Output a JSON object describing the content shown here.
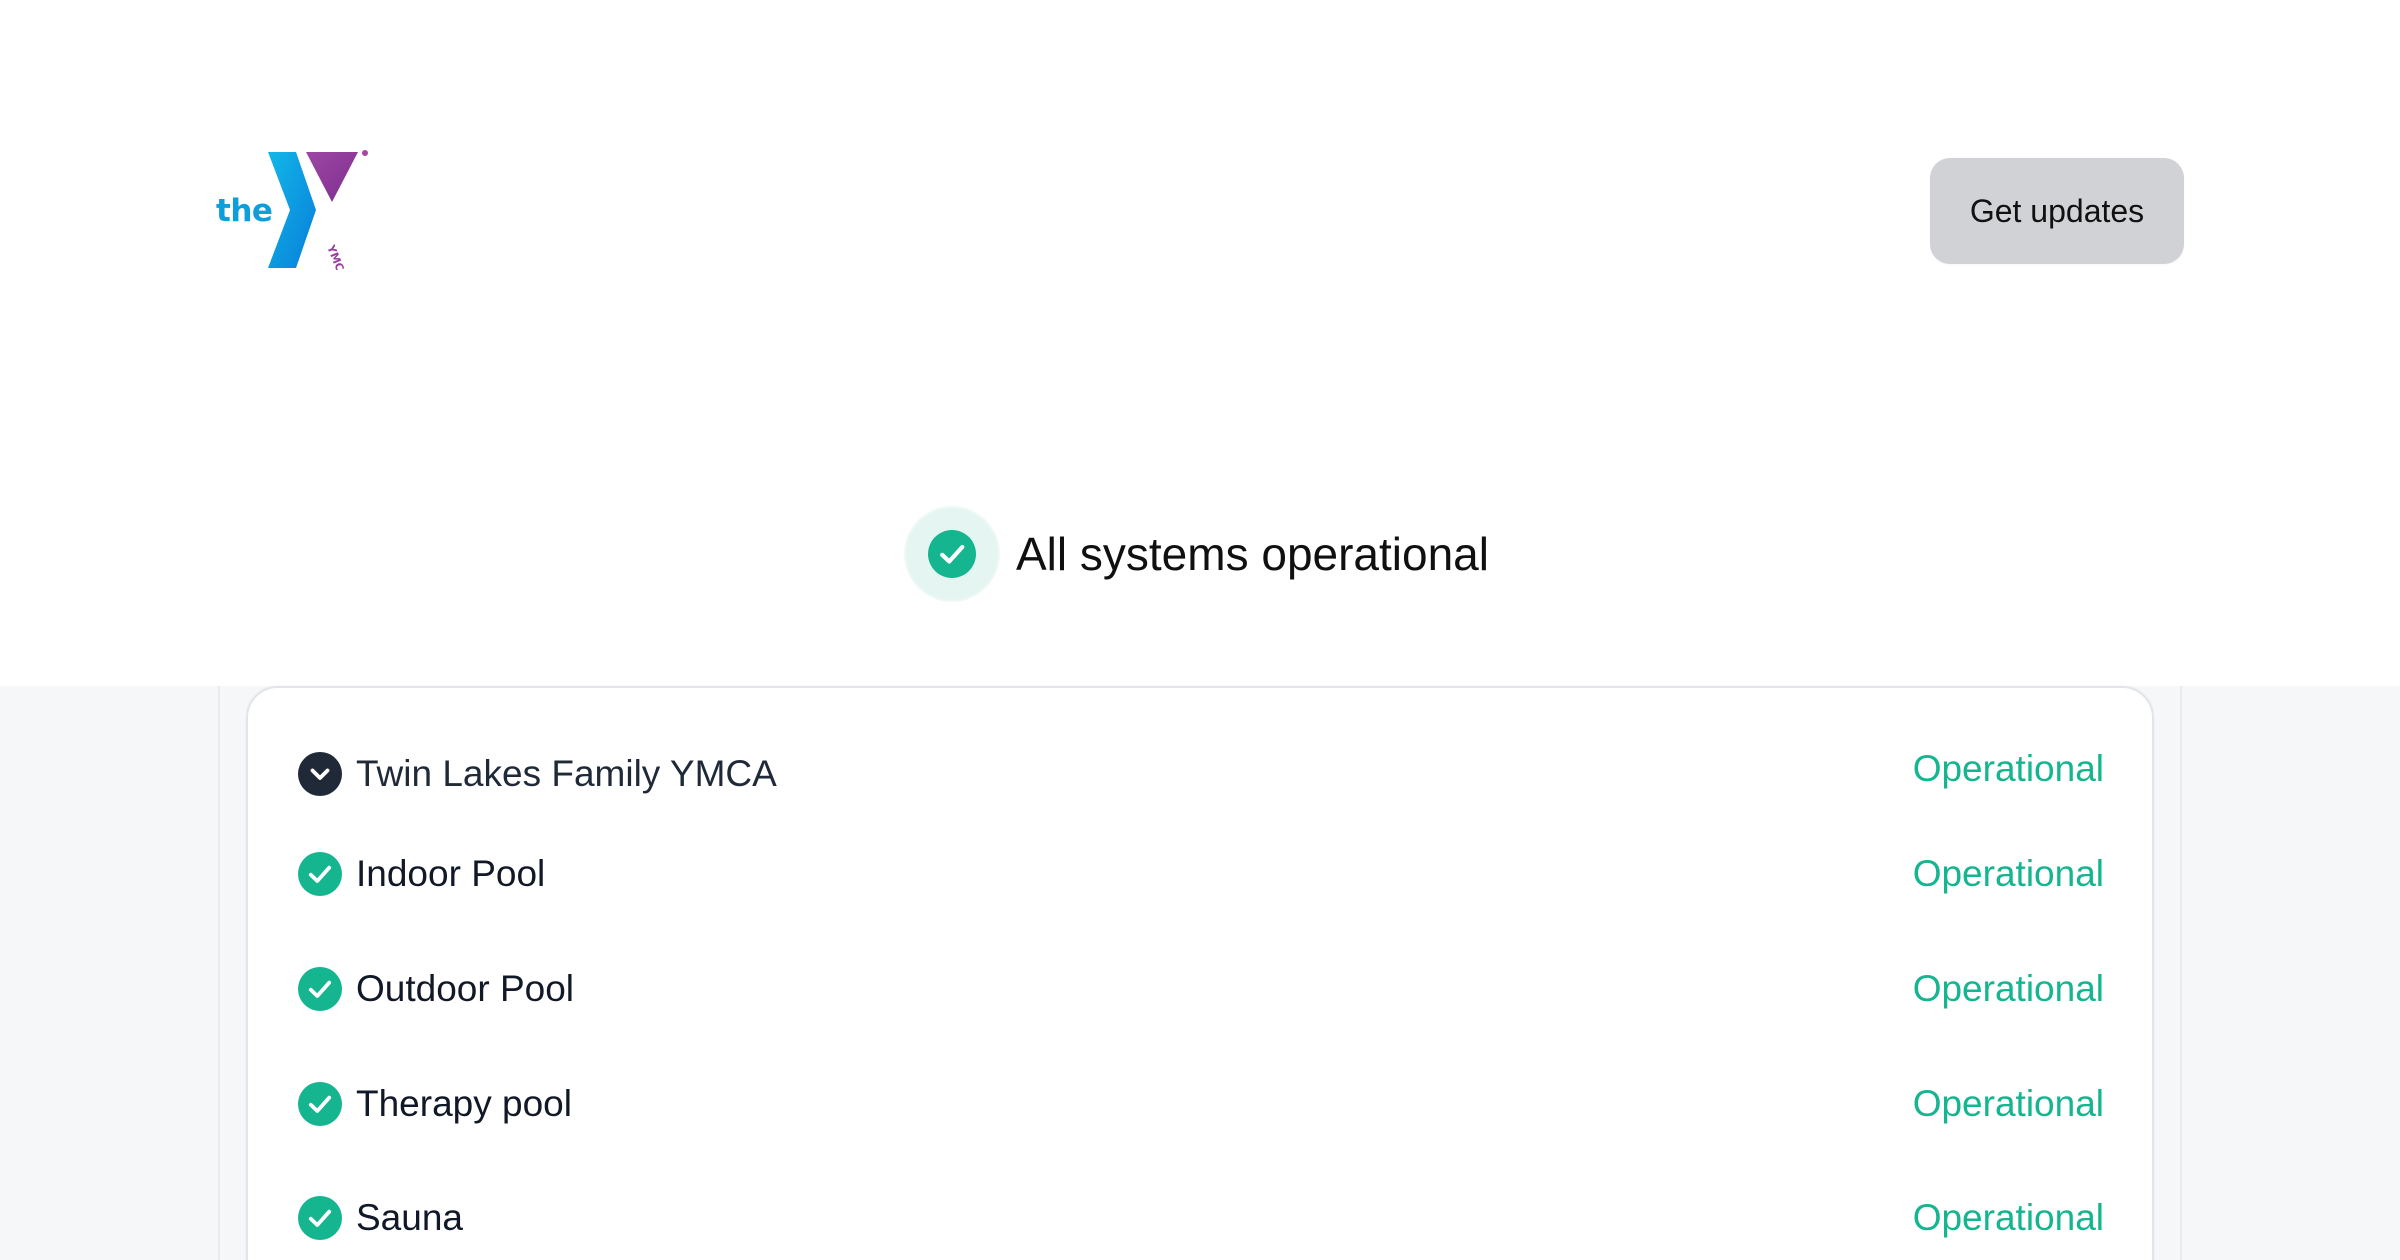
{
  "header": {
    "logo": {
      "word": "the",
      "vertical_text": "YMCA",
      "colors": {
        "blue": "#0b9fdc",
        "purple": "#8c3c9b",
        "pink_purple": "#a9459d"
      }
    },
    "get_updates_label": "Get updates"
  },
  "overall_status": {
    "icon": "check-circle-icon",
    "text": "All systems operational",
    "color": "#14b58f"
  },
  "status_group": {
    "name": "Twin Lakes Family YMCA",
    "status": "Operational",
    "expand_icon": "chevron-down-icon",
    "items": [
      {
        "name": "Indoor Pool",
        "status": "Operational",
        "icon": "check-circle-icon"
      },
      {
        "name": "Outdoor Pool",
        "status": "Operational",
        "icon": "check-circle-icon"
      },
      {
        "name": "Therapy pool",
        "status": "Operational",
        "icon": "check-circle-icon"
      },
      {
        "name": "Sauna",
        "status": "Operational",
        "icon": "check-circle-icon"
      }
    ]
  },
  "colors": {
    "operational": "#14b58f",
    "button_bg": "#d1d2d5",
    "group_icon": "#1f2937",
    "page_lower_bg": "#f6f7f9"
  }
}
